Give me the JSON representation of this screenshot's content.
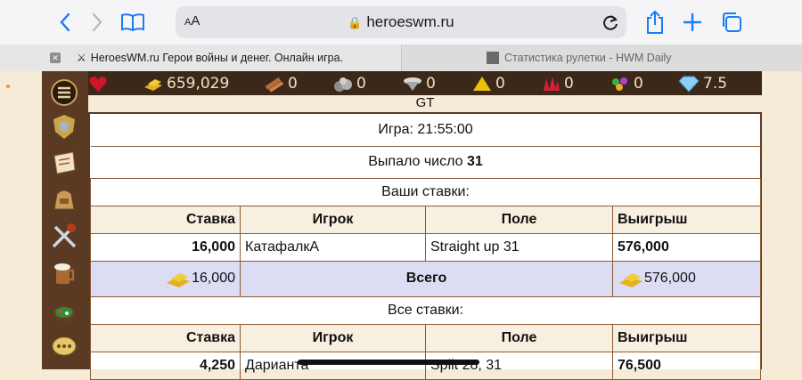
{
  "browser": {
    "address_aa_small": "A",
    "address_aa_big": "A",
    "url": "heroeswm.ru",
    "tabs": [
      {
        "label": "HeroesWM.ru Герои войны и денег. Онлайн игра."
      },
      {
        "label": "Статистика рулетки - HWM Daily"
      }
    ]
  },
  "resources": [
    {
      "icon": "gold-icon",
      "value": "659,029"
    },
    {
      "icon": "wood-icon",
      "value": "0"
    },
    {
      "icon": "ore-icon",
      "value": "0"
    },
    {
      "icon": "mercury-icon",
      "value": "0"
    },
    {
      "icon": "sulfur-icon",
      "value": "0"
    },
    {
      "icon": "crystal-icon",
      "value": "0"
    },
    {
      "icon": "gems-icon",
      "value": "0"
    },
    {
      "icon": "diamond-icon",
      "value": "7.5"
    }
  ],
  "page": {
    "title": "GT",
    "game_time": "Игра: 21:55:00",
    "dropped_label": "Выпало число",
    "dropped_number": "31",
    "your_bets_title": "Ваши ставки:",
    "all_bets_title": "Все ставки:",
    "columns": [
      "Ставка",
      "Игрок",
      "Поле",
      "Выигрыш"
    ],
    "your_bets": [
      {
        "bet": "16,000",
        "player": "КатафалкA",
        "field": "Straight up 31",
        "win": "576,000"
      }
    ],
    "total": {
      "bet": "16,000",
      "label": "Всего",
      "win": "576,000"
    },
    "all_bets": [
      {
        "bet": "4,250",
        "player": "Дарианта",
        "field": "Split 28, 31",
        "win": "76,500"
      }
    ]
  }
}
